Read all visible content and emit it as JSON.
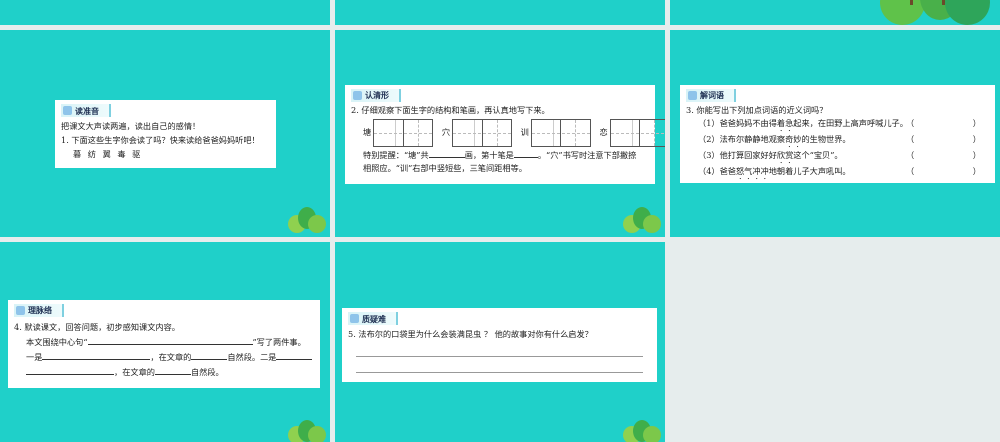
{
  "slide1": {
    "tag": "读准音",
    "intro": "把课文大声读两遍，读出自己的感情！",
    "q1": "1. 下面这些生字你会读了吗？快来读给爸爸妈妈听吧！",
    "chars": "暮  纺  翼  毒  驱"
  },
  "slide2": {
    "tag": "认清形",
    "q2": "2. 仔细观察下面生字的结构和笔画，再认真地写下来。",
    "chars": [
      "塘",
      "穴",
      "训",
      "恋"
    ],
    "tip_a": "特别提醒：“塘”共",
    "tip_b": "画，第十笔是",
    "tip_c": "。“穴”书写时注意下部撇捺",
    "tip_d": "相照应。“训”右部中竖短些，三笔间距相等。"
  },
  "slide3": {
    "tag": "解词语",
    "q3": "3. 你能写出下列加点词语的近义词吗？",
    "items": [
      {
        "pre": "（1）爸爸妈妈不由得",
        "dot": "着急",
        "post": "起来，在田野上高声呼喊儿子。"
      },
      {
        "pre": "（2）法布尔静静地观察",
        "dot": "奇妙",
        "post": "的生物世界。"
      },
      {
        "pre": "（3）他打算回家好好",
        "dot": "欣赏",
        "post": "这个“宝贝”。"
      },
      {
        "pre": "（4）爸爸",
        "dot": "怒气冲冲",
        "post": "地朝着儿子大声吼叫。"
      }
    ],
    "paren_open": "（",
    "paren_close": "）"
  },
  "slide4": {
    "tag": "理脉络",
    "q4": "4. 默读课文，回答问题，初步感知课文内容。",
    "l1a": "本文围绕中心句“",
    "l1b": "”写了两件事。",
    "l2a": "一是",
    "l2b": "，在文章的",
    "l2c": "自然段。二是",
    "l3a": "，在文章的",
    "l3b": "自然段。"
  },
  "slide5": {
    "tag": "质疑难",
    "q5": "5. 法布尔的口袋里为什么会装满昆虫 ？ 他的故事对你有什么启发？"
  }
}
